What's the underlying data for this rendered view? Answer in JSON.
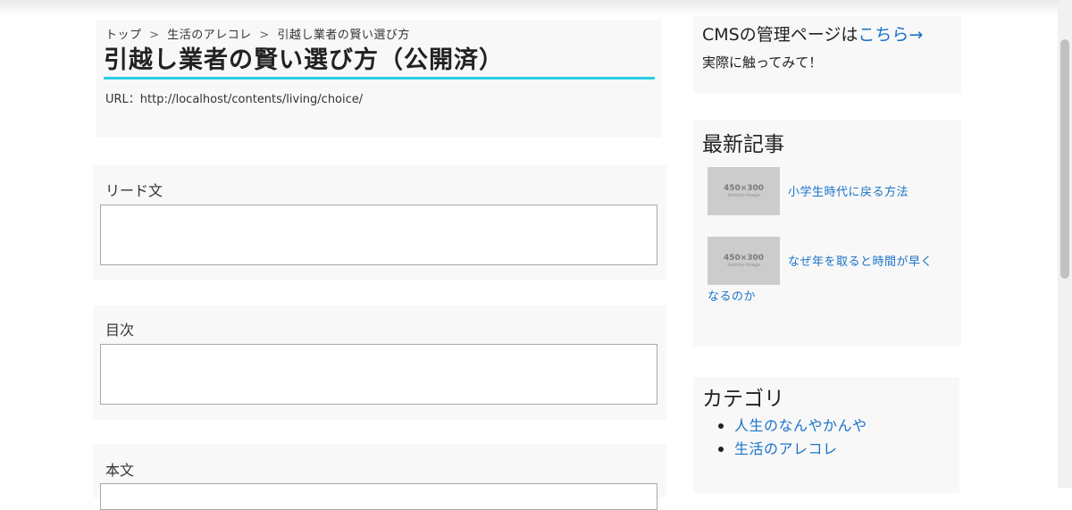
{
  "breadcrumb": {
    "items": [
      "トップ",
      "生活のアレコレ",
      "引越し業者の賢い選び方"
    ],
    "separator": ">"
  },
  "page": {
    "title": "引越し業者の賢い選び方（公開済）",
    "url": "URL：http://localhost/contents/living/choice/",
    "accent_color": "#2ccce4"
  },
  "fields": {
    "lead": {
      "label": "リード文",
      "value": ""
    },
    "toc": {
      "label": "目次",
      "value": ""
    },
    "body": {
      "label": "本文",
      "value": ""
    }
  },
  "sidebar": {
    "cms": {
      "text": "CMSの管理ページは",
      "link": "こちら→",
      "sub": "実際に触ってみて！"
    },
    "latest": {
      "heading": "最新記事",
      "articles": [
        {
          "thumb_label": "450×300",
          "thumb_sub": "dummy-image",
          "title": "小学生時代に戻る方法"
        },
        {
          "thumb_label": "450×300",
          "thumb_sub": "dummy-image",
          "title_line1": "なぜ年を取ると時間が早く",
          "title_line2": "なるのか"
        }
      ]
    },
    "categories": {
      "heading": "カテゴリ",
      "items": [
        "人生のなんやかんや",
        "生活のアレコレ"
      ]
    },
    "link_color": "#1a73c9"
  }
}
